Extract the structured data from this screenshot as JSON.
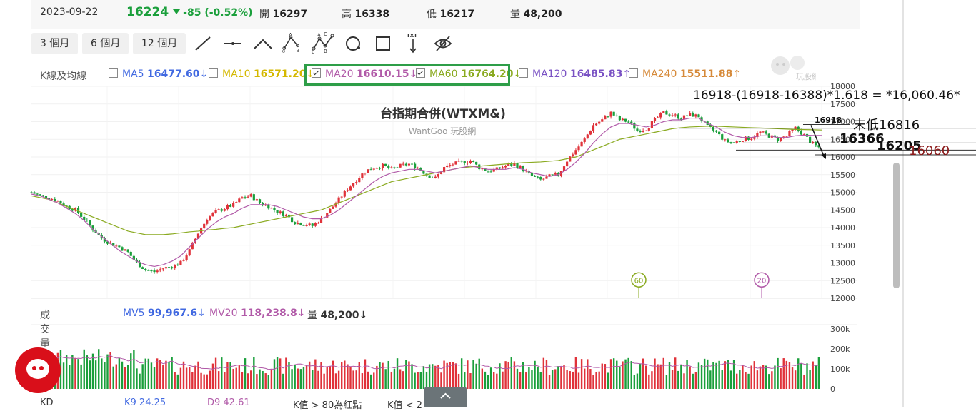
{
  "quote": {
    "date": "2023-09-22",
    "price": "16224",
    "change": "-85 (-0.52%)",
    "open_label": "開",
    "open": "16297",
    "high_label": "高",
    "high": "16338",
    "low_label": "低",
    "low": "16217",
    "vol_label": "量",
    "volume": "48,200"
  },
  "colors": {
    "up": "#e0323a",
    "down": "#1a9f3b",
    "ma5": "#4169e1",
    "ma10": "#d4b800",
    "ma20": "#b15aa8",
    "ma60": "#8aaa20",
    "ma120": "#7a52c4",
    "ma240": "#d68a3a",
    "highlight": "#2e9e48"
  },
  "range_buttons": [
    "3 個月",
    "6 個月",
    "12 個月"
  ],
  "tool_icons": [
    "line-tool-icon",
    "horizontal-line-icon",
    "angle-line-icon",
    "abc-wave-icon",
    "abcd-wave-icon",
    "circle-icon",
    "rectangle-icon",
    "text-tool-icon",
    "hide-drawings-icon"
  ],
  "tool_labels": {
    "txt": "TXT",
    "a": "A",
    "b": "B",
    "c": "C",
    "o": "0"
  },
  "ma_legend": {
    "title": "K線及均線",
    "items": [
      {
        "name": "MA5",
        "value": "16477.60",
        "arrow": "↓",
        "checked": false
      },
      {
        "name": "MA10",
        "value": "16571.20",
        "arrow": "↓",
        "checked": false
      },
      {
        "name": "MA20",
        "value": "16610.15",
        "arrow": "↓",
        "checked": true
      },
      {
        "name": "MA60",
        "value": "16764.20",
        "arrow": "↓",
        "checked": true
      },
      {
        "name": "MA120",
        "value": "16485.83",
        "arrow": "↑",
        "checked": false
      },
      {
        "name": "MA240",
        "value": "15511.88",
        "arrow": "↑",
        "checked": false
      }
    ]
  },
  "watermark": "玩股網",
  "volume_legend": {
    "title": "成交量",
    "mv5_label": "MV5",
    "mv5": "99,967.6",
    "mv5_arrow": "↓",
    "mv20_label": "MV20",
    "mv20": "118,238.8",
    "mv20_arrow": "↓",
    "vol_label": "量",
    "vol": "48,200",
    "vol_arrow": "↓"
  },
  "kd_legend": {
    "title": "KD",
    "k": "K9 24.25",
    "d": "D9 42.61",
    "text1": "K值 > 80為紅點",
    "text2": "K值 < 2"
  },
  "annotations": {
    "formula": "16918-(16918-16388)*1.618 = *16,060.46*",
    "low_note": "末低16816",
    "peak": "16918",
    "l1": "16366",
    "l2": "16205",
    "l3": "16060"
  },
  "chart_data": {
    "type": "candlestick",
    "title": "台指期合併(WTXM&)",
    "subtitle": "WantGoo 玩股網",
    "price_axis": {
      "min": 12000,
      "max": 18000,
      "ticks": [
        18000,
        17500,
        17000,
        16500,
        16000,
        15500,
        15000,
        14500,
        14000,
        13500,
        13000,
        12500,
        12000
      ]
    },
    "volume_axis": {
      "min": 0,
      "max": 300000,
      "ticks": [
        300000,
        200000,
        100000,
        0
      ],
      "tick_labels": [
        "300k",
        "200k",
        "100k",
        "0"
      ]
    },
    "close_series": [
      15000,
      14900,
      14850,
      14750,
      14600,
      14500,
      14250,
      13950,
      13700,
      13550,
      13450,
      13300,
      13000,
      12800,
      12750,
      12850,
      12900,
      13000,
      13350,
      13850,
      14250,
      14450,
      14550,
      14650,
      14850,
      14900,
      14700,
      14600,
      14450,
      14350,
      14150,
      14100,
      14050,
      14250,
      14500,
      14800,
      15100,
      15350,
      15600,
      15700,
      15750,
      15650,
      15750,
      15800,
      15700,
      15500,
      15400,
      15700,
      15800,
      15850,
      15900,
      15700,
      15600,
      15650,
      15750,
      15800,
      15650,
      15450,
      15350,
      15450,
      15500,
      15900,
      16200,
      16500,
      16900,
      17050,
      17250,
      17050,
      17000,
      16750,
      16800,
      17050,
      17250,
      17200,
      17100,
      17200,
      17150,
      16850,
      16700,
      16450,
      16400,
      16500,
      16550,
      16700,
      16600,
      16500,
      16600,
      16818,
      16620,
      16366,
      16224
    ],
    "ma20_series": [
      14950,
      14900,
      14800,
      14700,
      14550,
      14400,
      14200,
      13950,
      13750,
      13550,
      13350,
      13200,
      13050,
      12950,
      12900,
      12950,
      13050,
      13200,
      13450,
      13700,
      13950,
      14150,
      14300,
      14400,
      14550,
      14650,
      14650,
      14650,
      14600,
      14500,
      14400,
      14300,
      14250,
      14250,
      14350,
      14500,
      14700,
      14900,
      15100,
      15300,
      15450,
      15550,
      15600,
      15650,
      15650,
      15600,
      15550,
      15600,
      15650,
      15700,
      15750,
      15700,
      15650,
      15650,
      15650,
      15700,
      15650,
      15550,
      15500,
      15450,
      15500,
      15650,
      15850,
      16100,
      16400,
      16650,
      16850,
      16950,
      16950,
      16900,
      16850,
      16900,
      17000,
      17050,
      17050,
      17100,
      17100,
      16950,
      16850,
      16700,
      16600,
      16550,
      16550,
      16600,
      16600,
      16550,
      16550,
      16600,
      16620,
      16610,
      16610
    ],
    "ma60_series": [
      14900,
      14850,
      14800,
      14700,
      14600,
      14500,
      14400,
      14300,
      14200,
      14100,
      14000,
      13900,
      13850,
      13800,
      13800,
      13800,
      13820,
      13850,
      13880,
      13900,
      13930,
      13950,
      13980,
      14000,
      14050,
      14100,
      14150,
      14200,
      14250,
      14300,
      14350,
      14400,
      14450,
      14500,
      14600,
      14700,
      14800,
      14900,
      15000,
      15100,
      15200,
      15300,
      15350,
      15400,
      15450,
      15500,
      15550,
      15600,
      15650,
      15700,
      15720,
      15740,
      15760,
      15780,
      15800,
      15820,
      15840,
      15850,
      15860,
      15880,
      15900,
      15950,
      16000,
      16100,
      16200,
      16300,
      16400,
      16500,
      16550,
      16600,
      16650,
      16700,
      16750,
      16800,
      16830,
      16850,
      16860,
      16870,
      16870,
      16860,
      16850,
      16840,
      16830,
      16820,
      16810,
      16800,
      16790,
      16780,
      16775,
      16770,
      16764
    ],
    "markers": [
      {
        "label": "60",
        "price": 12500
      },
      {
        "label": "20",
        "price": 12500
      }
    ],
    "annotation_levels": [
      16918,
      16816,
      16366,
      16205,
      16060
    ]
  }
}
